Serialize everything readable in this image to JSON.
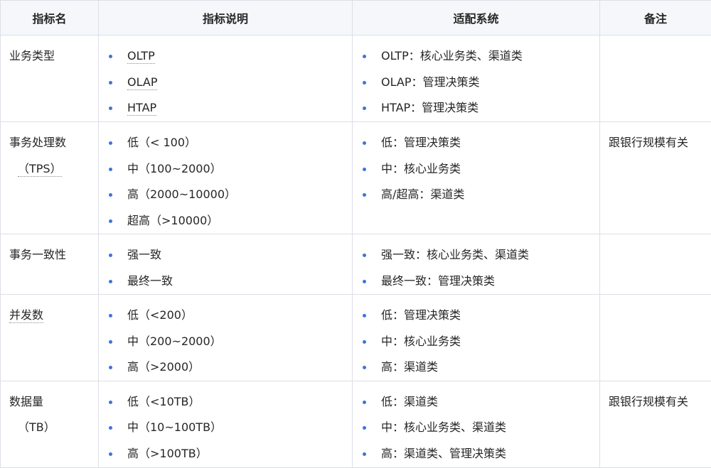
{
  "headers": [
    "指标名",
    "指标说明",
    "适配系统",
    "备注"
  ],
  "rows": [
    {
      "name": "业务类型",
      "name2": "",
      "desc": [
        "OLTP",
        "OLAP",
        "HTAP"
      ],
      "sys": [
        "OLTP：核心业务类、渠道类",
        "OLAP：管理决策类",
        "HTAP：管理决策类"
      ],
      "note": ""
    },
    {
      "name": "事务处理数",
      "name2": "（TPS）",
      "desc": [
        "低（< 100）",
        "中（100~2000）",
        "高（2000~10000）",
        "超高（>10000）"
      ],
      "sys": [
        "低：管理决策类",
        "中：核心业务类",
        "高/超高：渠道类"
      ],
      "note": "跟银行规模有关"
    },
    {
      "name": "事务一致性",
      "name2": "",
      "desc": [
        "强一致",
        "最终一致"
      ],
      "sys": [
        "强一致：核心业务类、渠道类",
        "最终一致：管理决策类"
      ],
      "note": ""
    },
    {
      "name": "并发数",
      "name2": "",
      "desc": [
        "低（<200）",
        "中（200~2000）",
        "高（>2000）"
      ],
      "sys": [
        "低：管理决策类",
        "中：核心业务类",
        "高：渠道类"
      ],
      "note": ""
    },
    {
      "name": "数据量",
      "name2": "（TB）",
      "desc": [
        "低（<10TB）",
        "中（10~100TB）",
        "高（>100TB）"
      ],
      "sys": [
        "低：渠道类",
        "中：核心业务类、渠道类",
        "高：渠道类、管理决策类"
      ],
      "note": "跟银行规模有关"
    }
  ]
}
